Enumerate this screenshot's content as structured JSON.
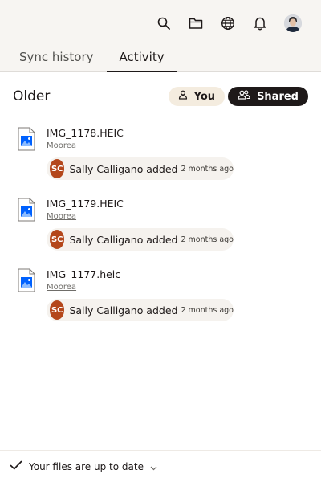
{
  "tabs": [
    {
      "label": "Sync history",
      "active": false
    },
    {
      "label": "Activity",
      "active": true
    }
  ],
  "section": {
    "title": "Older",
    "filters": {
      "you": "You",
      "shared": "Shared"
    }
  },
  "items": [
    {
      "file_name": "IMG_1178.HEIC",
      "folder": "Moorea",
      "user_initials": "SC",
      "action": "Sally Calligano added",
      "time": "2 months ago"
    },
    {
      "file_name": "IMG_1179.HEIC",
      "folder": "Moorea",
      "user_initials": "SC",
      "action": "Sally Calligano added",
      "time": "2 months ago"
    },
    {
      "file_name": "IMG_1177.heic",
      "folder": "Moorea",
      "user_initials": "SC",
      "action": "Sally Calligano added",
      "time": "2 months ago"
    }
  ],
  "footer": {
    "status": "Your files are up to date"
  },
  "colors": {
    "header_bg": "#f7f5f2",
    "shared_pill": "#1e1919",
    "you_pill": "#f4ecdf",
    "avatar_sc": "#b4471b",
    "file_icon_blue": "#0061fe"
  },
  "icons": [
    "search-icon",
    "folder-icon",
    "globe-icon",
    "bell-icon",
    "account-avatar",
    "person-icon",
    "people-icon",
    "image-file-icon",
    "checkmark-icon",
    "chevron-down-icon"
  ]
}
